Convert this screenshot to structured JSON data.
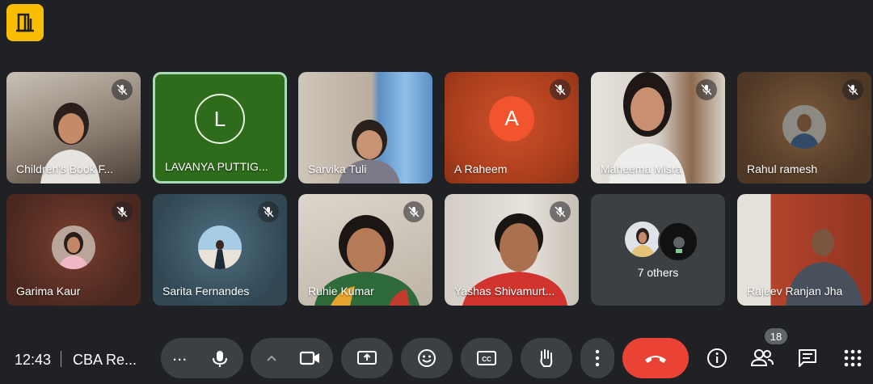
{
  "app": {
    "icon": "door-icon"
  },
  "tiles": [
    {
      "name": "Children's Book F...",
      "muted": true
    },
    {
      "name": "LAVANYA PUTTIG...",
      "muted": false,
      "avatar_letter": "L",
      "active_speaker": true
    },
    {
      "name": "Sarvika Tuli",
      "muted": false
    },
    {
      "name": "A Raheem",
      "muted": true,
      "avatar_letter": "A"
    },
    {
      "name": "Maheema Misra",
      "muted": true
    },
    {
      "name": "Rahul ramesh",
      "muted": true
    },
    {
      "name": "Garima Kaur",
      "muted": true
    },
    {
      "name": "Sarita Fernandes",
      "muted": true
    },
    {
      "name": "Ruhie Kumar",
      "muted": true
    },
    {
      "name": "Yashas Shivamurt...",
      "muted": true
    },
    {
      "name": "7 others",
      "muted": false
    },
    {
      "name": "Rajeev Ranjan Jha",
      "muted": false
    }
  ],
  "bottom_bar": {
    "time": "12:43",
    "meeting_title": "CBA Re...",
    "participants_count": "18",
    "more_label": "...",
    "controls": [
      "more-options",
      "microphone",
      "camera-chevron",
      "camera",
      "present-screen",
      "emoji",
      "captions",
      "raise-hand",
      "more-vert",
      "end-call",
      "info",
      "people",
      "chat",
      "activities"
    ]
  },
  "colors": {
    "background": "#202124",
    "control_bg": "#3c4043",
    "end_call": "#ea4335",
    "active_speaker_border": "#a8dab5",
    "app_icon": "#fbbc04"
  }
}
